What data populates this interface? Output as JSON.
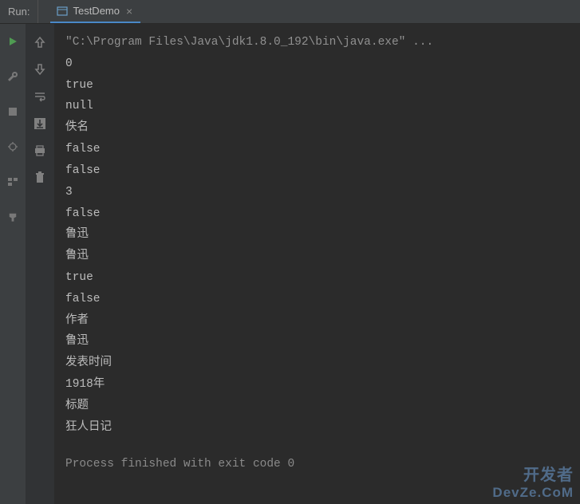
{
  "header": {
    "run_label": "Run:",
    "tab_label": "TestDemo",
    "tab_close": "×"
  },
  "console": {
    "command": "\"C:\\Program Files\\Java\\jdk1.8.0_192\\bin\\java.exe\" ...",
    "lines": [
      "0",
      "true",
      "null",
      "佚名",
      "false",
      "false",
      "3",
      "false",
      "鲁迅",
      "鲁迅",
      "true",
      "false",
      "作者",
      "鲁迅",
      "发表时间",
      "1918年",
      "标题",
      "狂人日记"
    ],
    "exit_message": "Process finished with exit code 0"
  },
  "watermark": {
    "line1": "开发者",
    "line2": "DevZe.CoM"
  }
}
